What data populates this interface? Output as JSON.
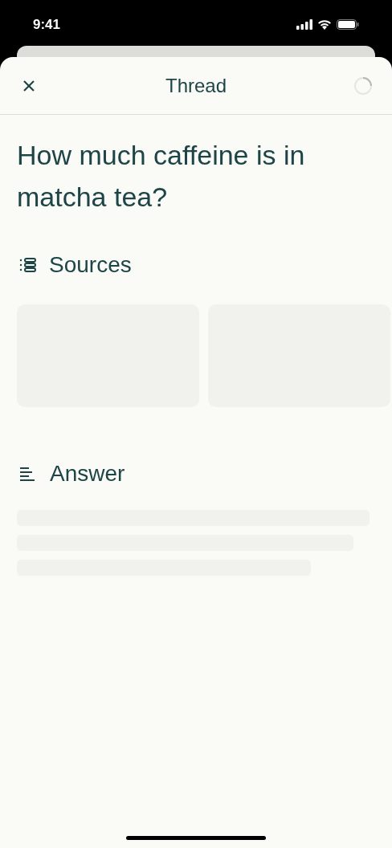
{
  "status_bar": {
    "time": "9:41"
  },
  "header": {
    "title": "Thread",
    "loading": true
  },
  "question": "How much caffeine is in matcha tea?",
  "sources": {
    "heading": "Sources",
    "loading": true
  },
  "answer": {
    "heading": "Answer",
    "loading": true
  }
}
